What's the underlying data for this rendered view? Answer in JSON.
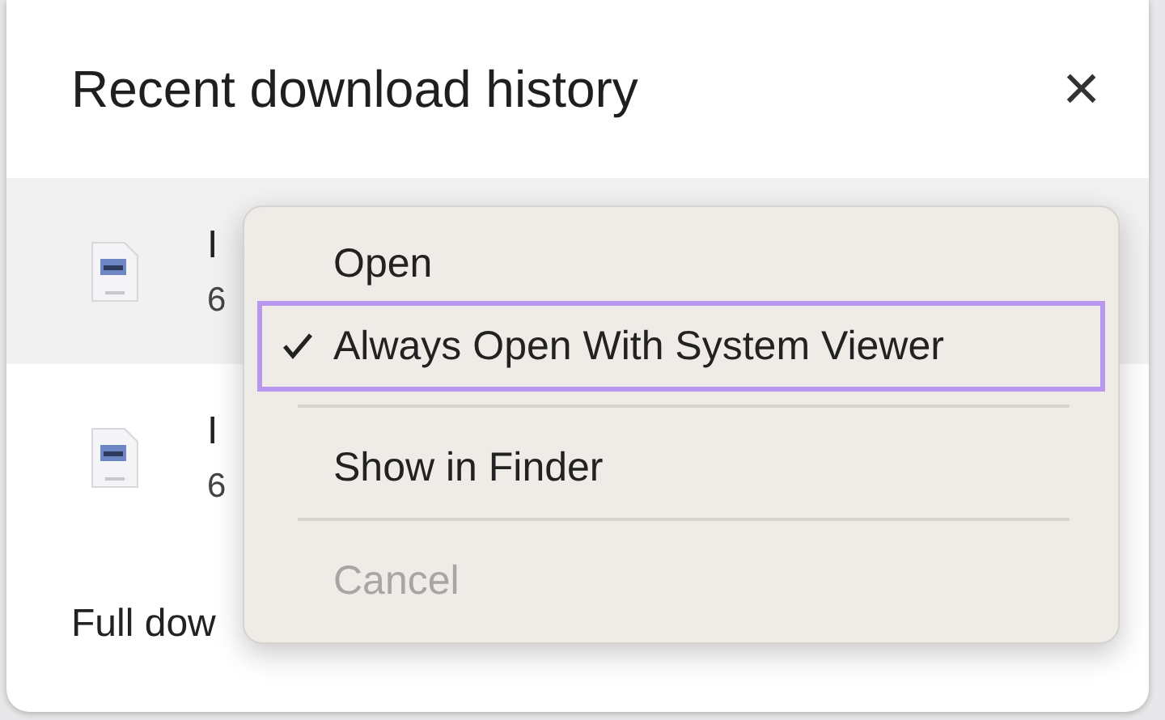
{
  "dialog": {
    "title": "Recent download history",
    "close": "×"
  },
  "downloads": [
    {
      "name": "I",
      "detail": "6",
      "selected": true
    },
    {
      "name": "I",
      "detail": "6",
      "selected": false
    }
  ],
  "footer": {
    "text": "Full dow"
  },
  "context_menu": [
    {
      "kind": "item",
      "label": "Open",
      "checked": false,
      "disabled": false,
      "selected": false
    },
    {
      "kind": "item",
      "label": "Always Open With System Viewer",
      "checked": true,
      "disabled": false,
      "selected": true
    },
    {
      "kind": "separator"
    },
    {
      "kind": "item",
      "label": "Show in Finder",
      "checked": false,
      "disabled": false,
      "selected": false
    },
    {
      "kind": "separator"
    },
    {
      "kind": "item",
      "label": "Cancel",
      "checked": false,
      "disabled": true,
      "selected": false
    }
  ]
}
